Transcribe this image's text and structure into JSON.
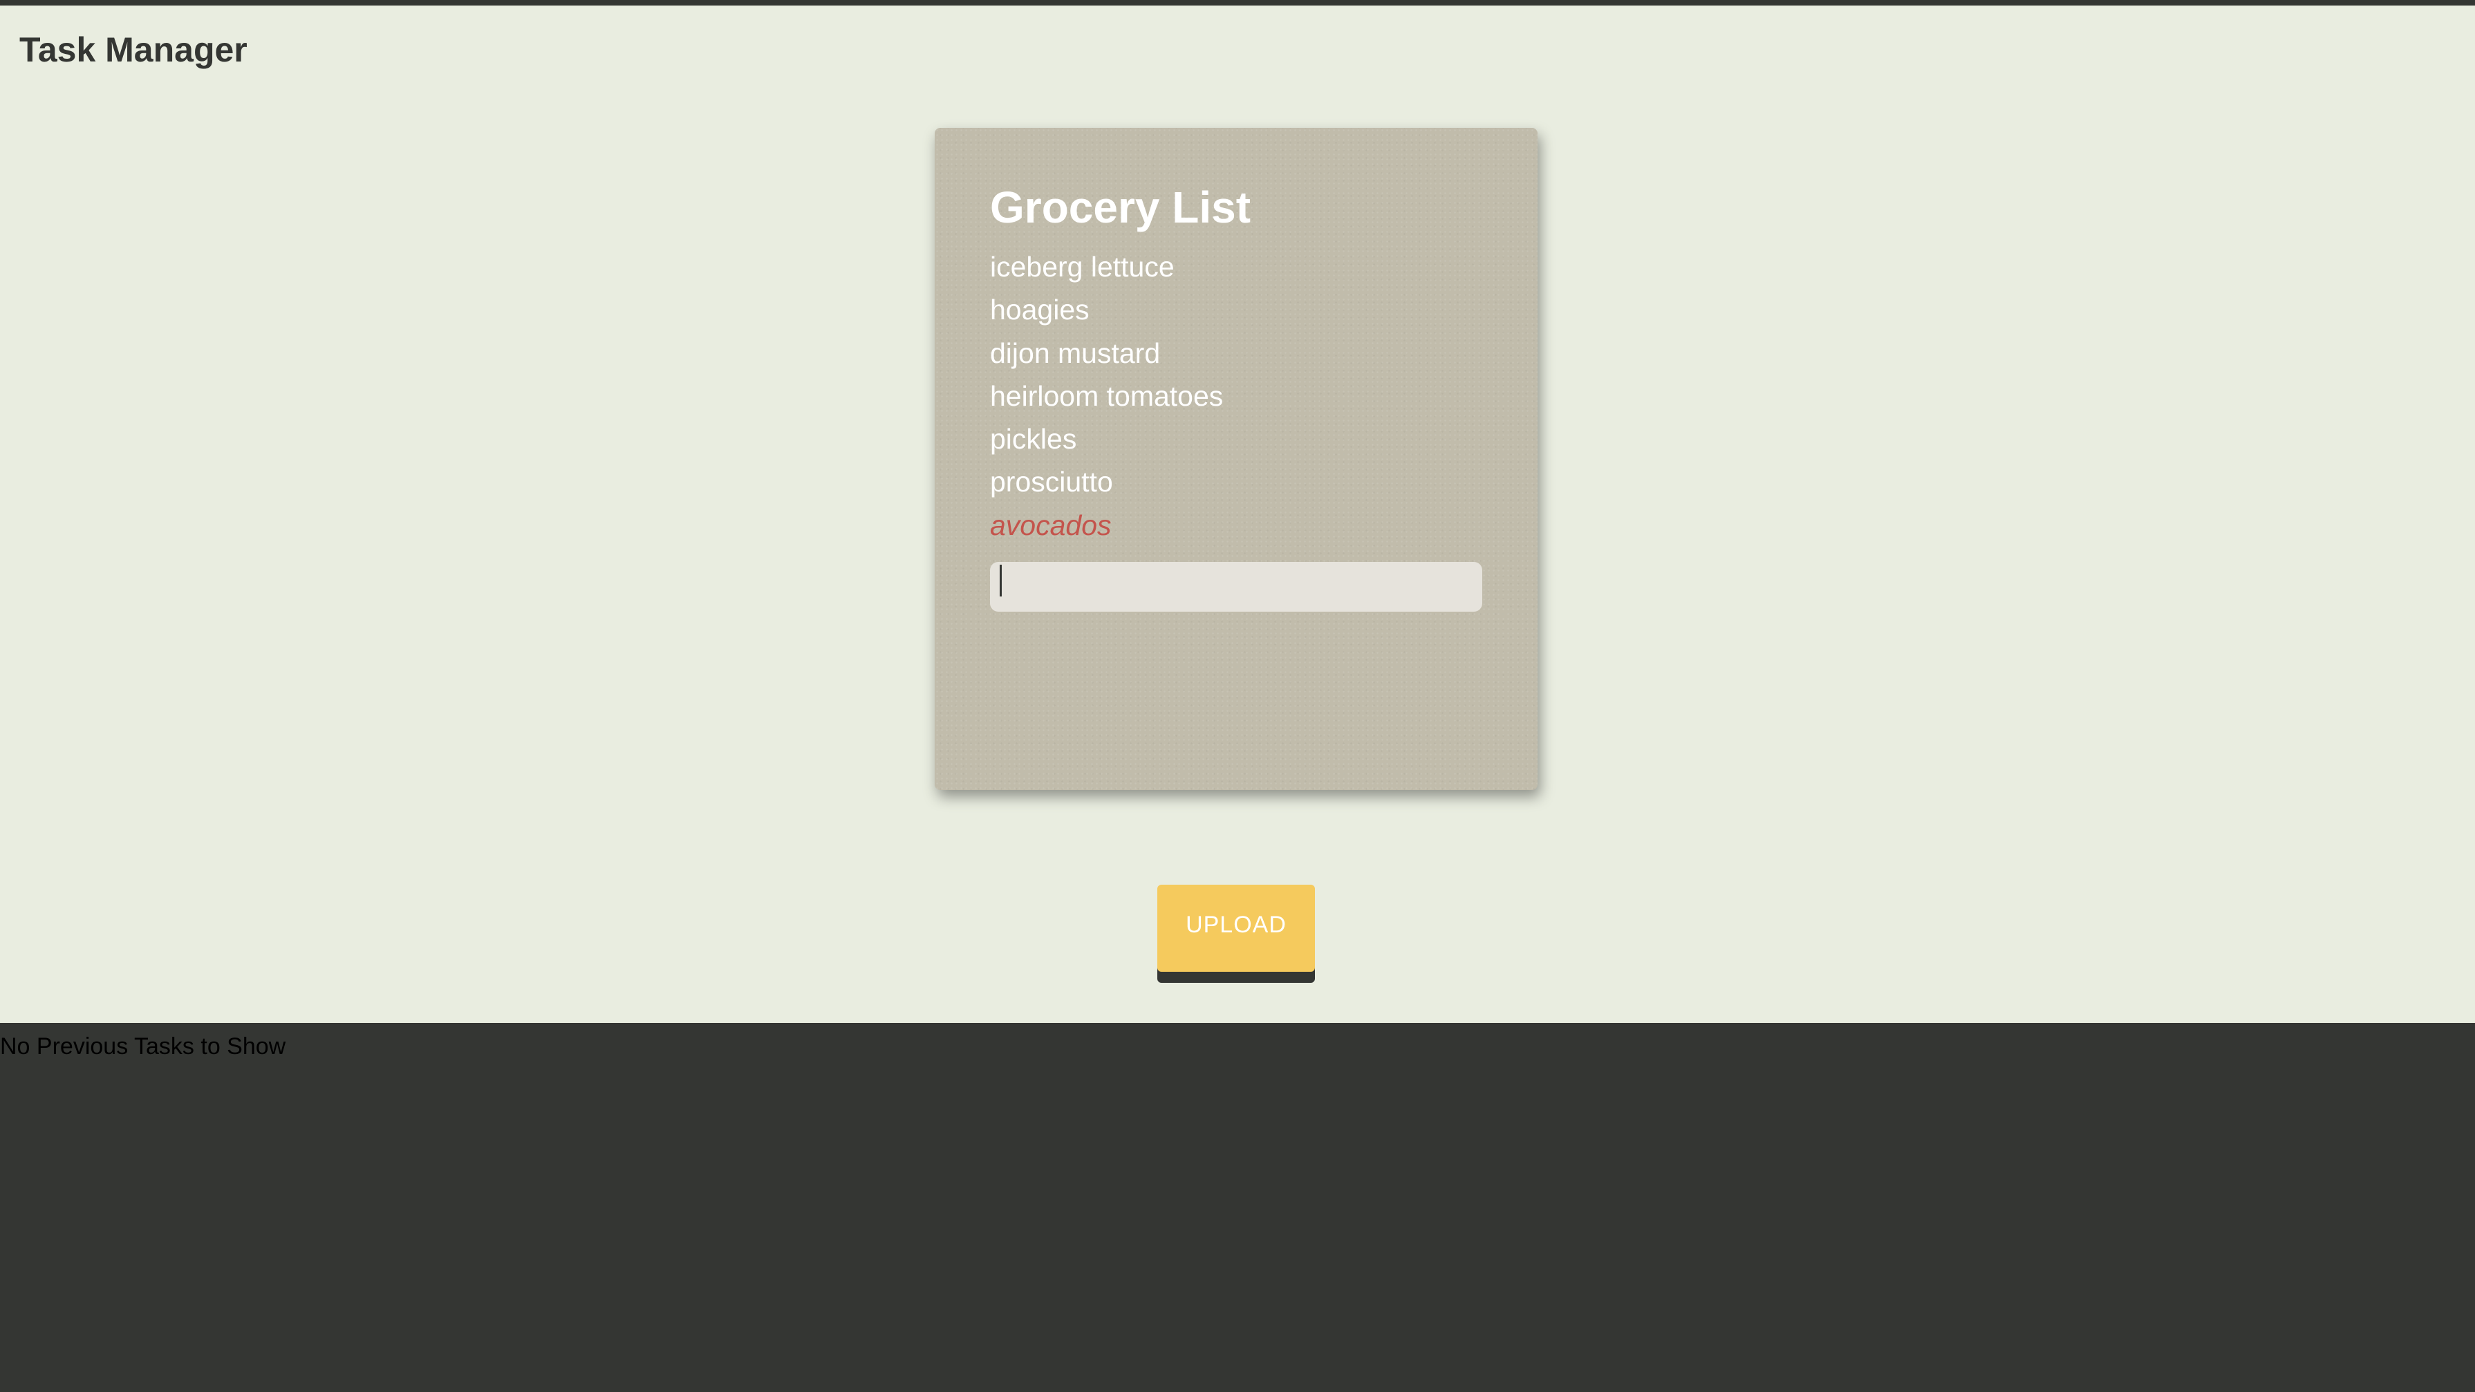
{
  "header": {
    "title": "Task Manager"
  },
  "card": {
    "title": "Grocery List",
    "items": [
      "iceberg lettuce",
      "hoagies",
      "dijon mustard",
      "heirloom tomatoes",
      "pickles",
      "prosciutto"
    ],
    "highlighted_item": "avocados",
    "input": {
      "value": "",
      "placeholder": ""
    }
  },
  "upload_button": {
    "label": "UPLOAD"
  },
  "footer": {
    "message": "No Previous Tasks to Show"
  },
  "colors": {
    "page_background": "#e9ede0",
    "dark": "#343633",
    "card_background": "#c1bcab",
    "highlight_text": "#c4544c",
    "button": "#f5ca5d"
  }
}
